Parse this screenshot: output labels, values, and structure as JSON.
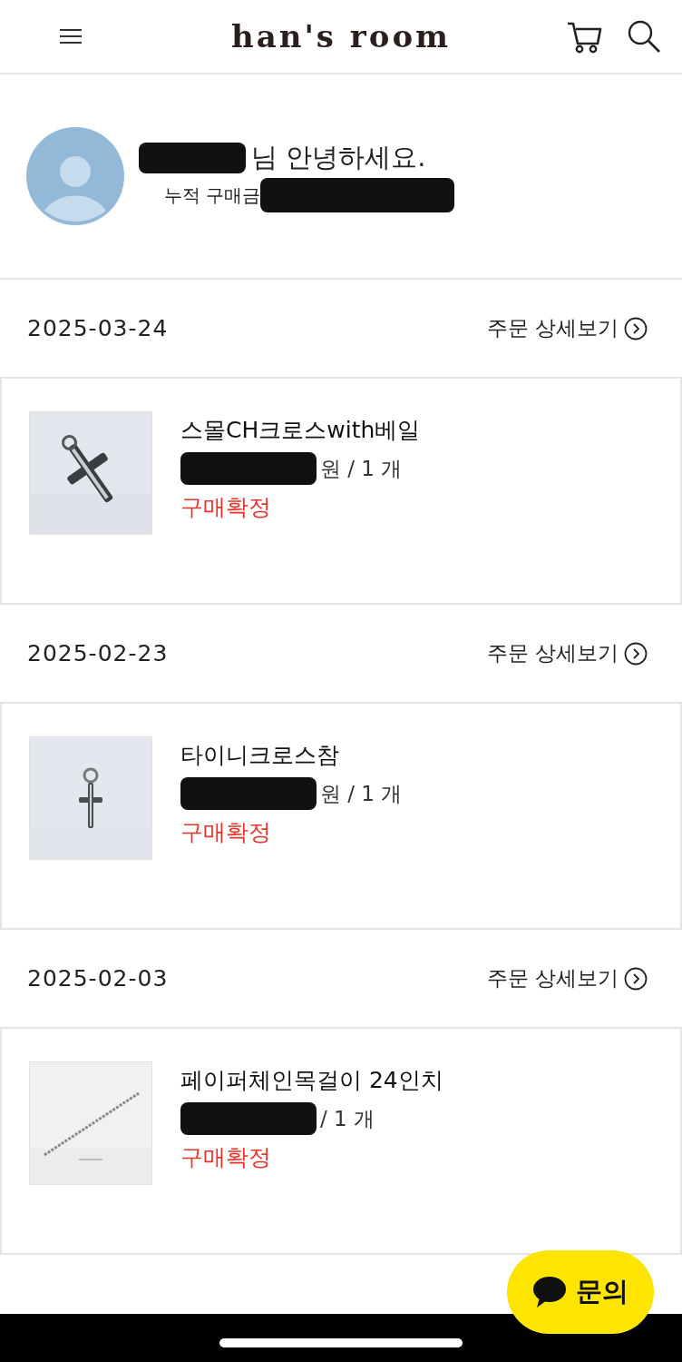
{
  "header": {
    "logo": "han's room"
  },
  "profile": {
    "greeting": "님 안녕하세요.",
    "total_label": "누적 구매금"
  },
  "orders": [
    {
      "date": "2025-03-24",
      "detail_link": "주문 상세보기",
      "product": {
        "name": "스몰CH크로스with베일",
        "price_visible": "원 / 1 개",
        "status": "구매확정"
      }
    },
    {
      "date": "2025-02-23",
      "detail_link": "주문 상세보기",
      "product": {
        "name": "타이니크로스참",
        "price_visible": "원 / 1 개",
        "status": "구매확정"
      }
    },
    {
      "date": "2025-02-03",
      "detail_link": "주문 상세보기",
      "product": {
        "name": "페이퍼체인목걸이 24인치",
        "price_visible": "/ 1 개",
        "status": "구매확정"
      }
    }
  ],
  "chat_button": {
    "label": "문의"
  }
}
